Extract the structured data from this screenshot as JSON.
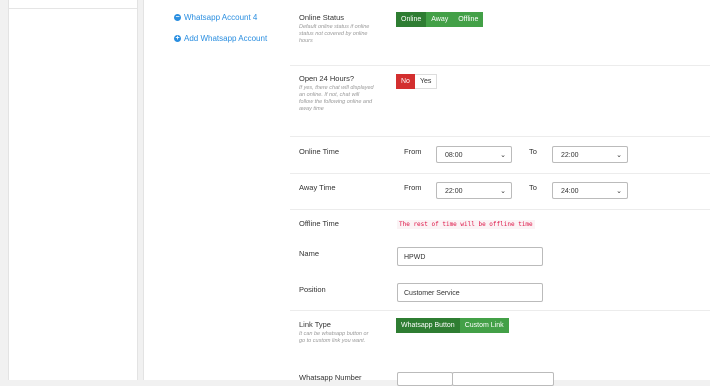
{
  "accounts": {
    "current": "Whatsapp Account 4",
    "add_label": "Add Whatsapp Account"
  },
  "online_status": {
    "label": "Online Status",
    "help": [
      "Default online status if online",
      "status not covered by online",
      "hours"
    ],
    "options": [
      "Online",
      "Away",
      "Offline"
    ],
    "selected": "Online"
  },
  "open_24": {
    "label": "Open 24 Hours?",
    "help": [
      "If yes, there chat will displayed",
      "an online. If not, chat will",
      "follow the following online and",
      "away time"
    ],
    "options": [
      "No",
      "Yes"
    ],
    "selected": "No"
  },
  "online_time": {
    "label": "Online Time",
    "from_label": "From",
    "from": "08:00",
    "to_label": "To",
    "to": "22:00"
  },
  "away_time": {
    "label": "Away Time",
    "from_label": "From",
    "from": "22:00",
    "to_label": "To",
    "to": "24:00"
  },
  "offline_time": {
    "label": "Offline Time",
    "note": "The rest of time will be offline time"
  },
  "name": {
    "label": "Name",
    "value": "HPWD"
  },
  "position": {
    "label": "Position",
    "value": "Customer Service"
  },
  "link_type": {
    "label": "Link Type",
    "help": [
      "It can be whatsapp button or",
      "go to custom link you want."
    ],
    "options": [
      "Whatsapp Button",
      "Custom Link"
    ],
    "selected": "Whatsapp Button"
  },
  "whatsapp_number": {
    "label": "Whatsapp Number"
  },
  "colors": {
    "accent": "#2a8ee0",
    "green_dark": "#2e7d32",
    "green": "#43a047",
    "red": "#d32f2f"
  }
}
